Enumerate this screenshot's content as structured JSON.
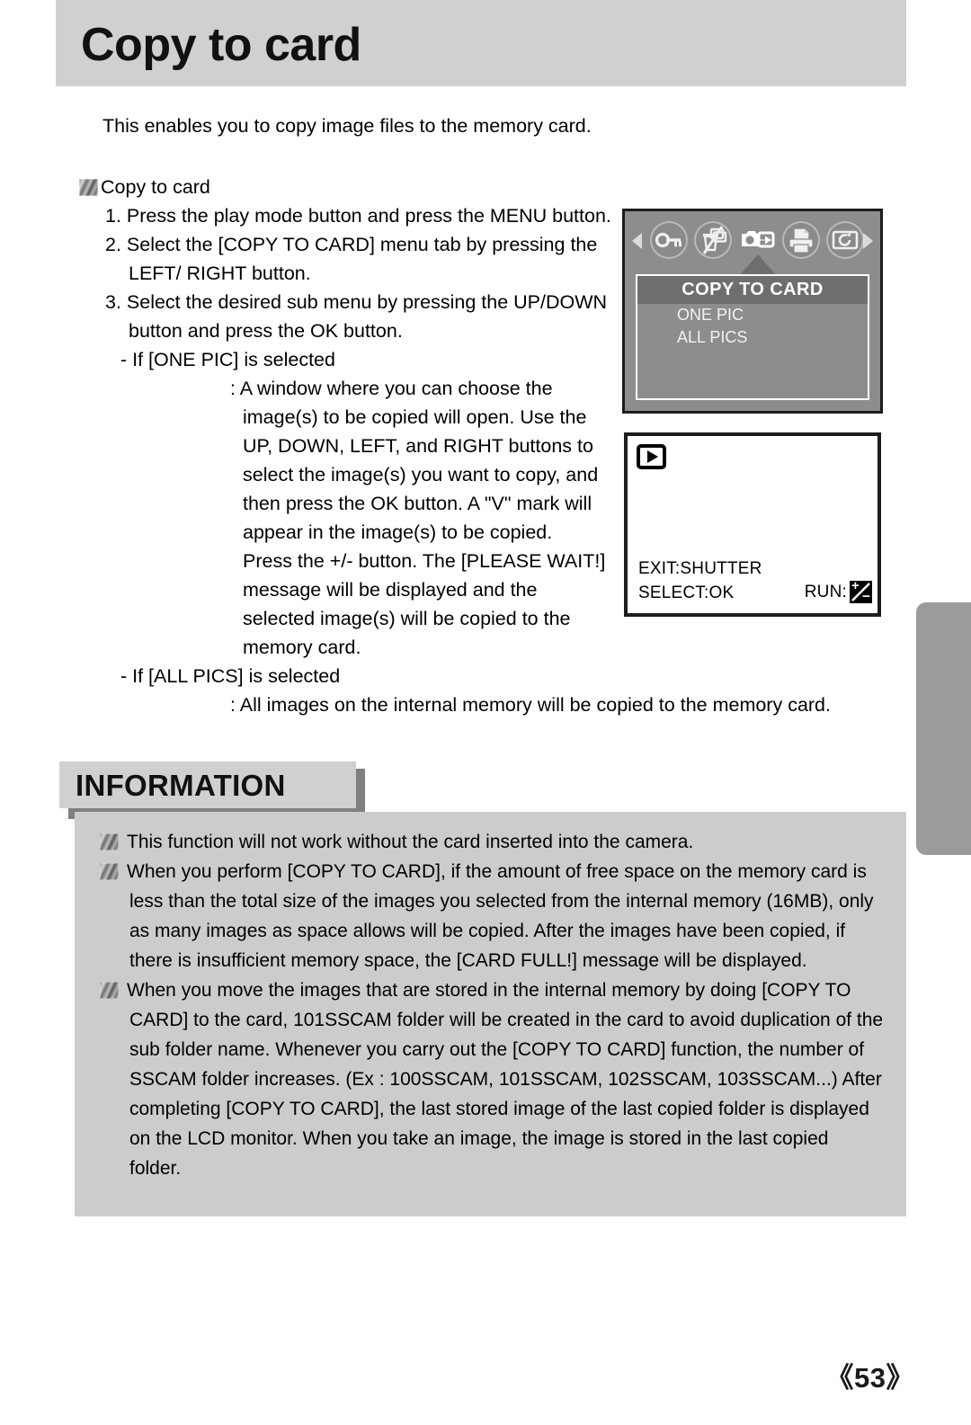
{
  "page": {
    "title": "Copy to card",
    "number": "《53》"
  },
  "intro": {
    "text": "This enables you to copy image files to the memory card."
  },
  "procedure": {
    "heading": "Copy to card",
    "steps": [
      "1. Press the play mode button and press the MENU button.",
      "2. Select the [COPY TO CARD] menu tab by pressing the LEFT/ RIGHT button.",
      "3. Select the desired sub menu by pressing the UP/DOWN button and press the OK button."
    ],
    "sub_one_pic_label": "- If [ONE PIC] is selected",
    "sub_one_pic_detail": ": A window where you can choose the image(s) to be copied will open. Use the UP, DOWN, LEFT, and RIGHT buttons to select the image(s) you want to copy, and then press the OK button. A \"V\" mark will appear in the image(s) to be copied. Press the +/- button. The [PLEASE WAIT!] message will be displayed and the selected image(s) will be copied to the memory card.",
    "sub_all_pics_label": "- If [ALL PICS] is selected",
    "sub_all_pics_detail": ": All images on the internal memory will be copied to the memory card."
  },
  "lcd_menu": {
    "tabs": [
      "protect-key-icon",
      "delete-trash-icon",
      "copy-to-card-icon",
      "dpof-printer-icon",
      "resize-camera-icon"
    ],
    "active_tab_index": 2,
    "nav_left": "nav-left-arrow-icon",
    "nav_right": "nav-right-arrow-icon",
    "title": "COPY TO CARD",
    "options": [
      "ONE PIC",
      "ALL PICS"
    ]
  },
  "lcd_select": {
    "mode_icon": "play-mode-icon",
    "exit_label": "EXIT:SHUTTER",
    "select_label": "SELECT:OK",
    "run_label": "RUN:",
    "run_icon": "plus-minus-button-icon"
  },
  "information": {
    "tab_label": "INFORMATION",
    "items": [
      "This function will not work without the card inserted into the camera.",
      "When you perform [COPY TO CARD], if the amount of free space on the memory card is less than the total size of the images you selected from the internal memory (16MB), only as many images as space allows will be copied. After the images have been copied, if there is insufficient memory space, the [CARD FULL!] message will be displayed.",
      "When you move the images that are stored in the internal memory by doing [COPY TO CARD] to the card, 101SSCAM folder will be created in the card to avoid duplication of the sub folder name. Whenever you carry out the [COPY TO CARD] function, the number of SSCAM folder increases. (Ex : 100SSCAM, 101SSCAM, 102SSCAM, 103SSCAM...) After completing [COPY TO CARD], the last stored image of the last copied folder is displayed on the LCD monitor. When you take an image, the image is stored in the last copied folder."
    ]
  },
  "colors": {
    "header_bg": "#d0d0d0",
    "info_bg": "#cccccc",
    "lcd_bg": "#8d8d8d",
    "lcd_title_bg": "#6e6e6e",
    "side_tab": "#9b9b9b"
  }
}
